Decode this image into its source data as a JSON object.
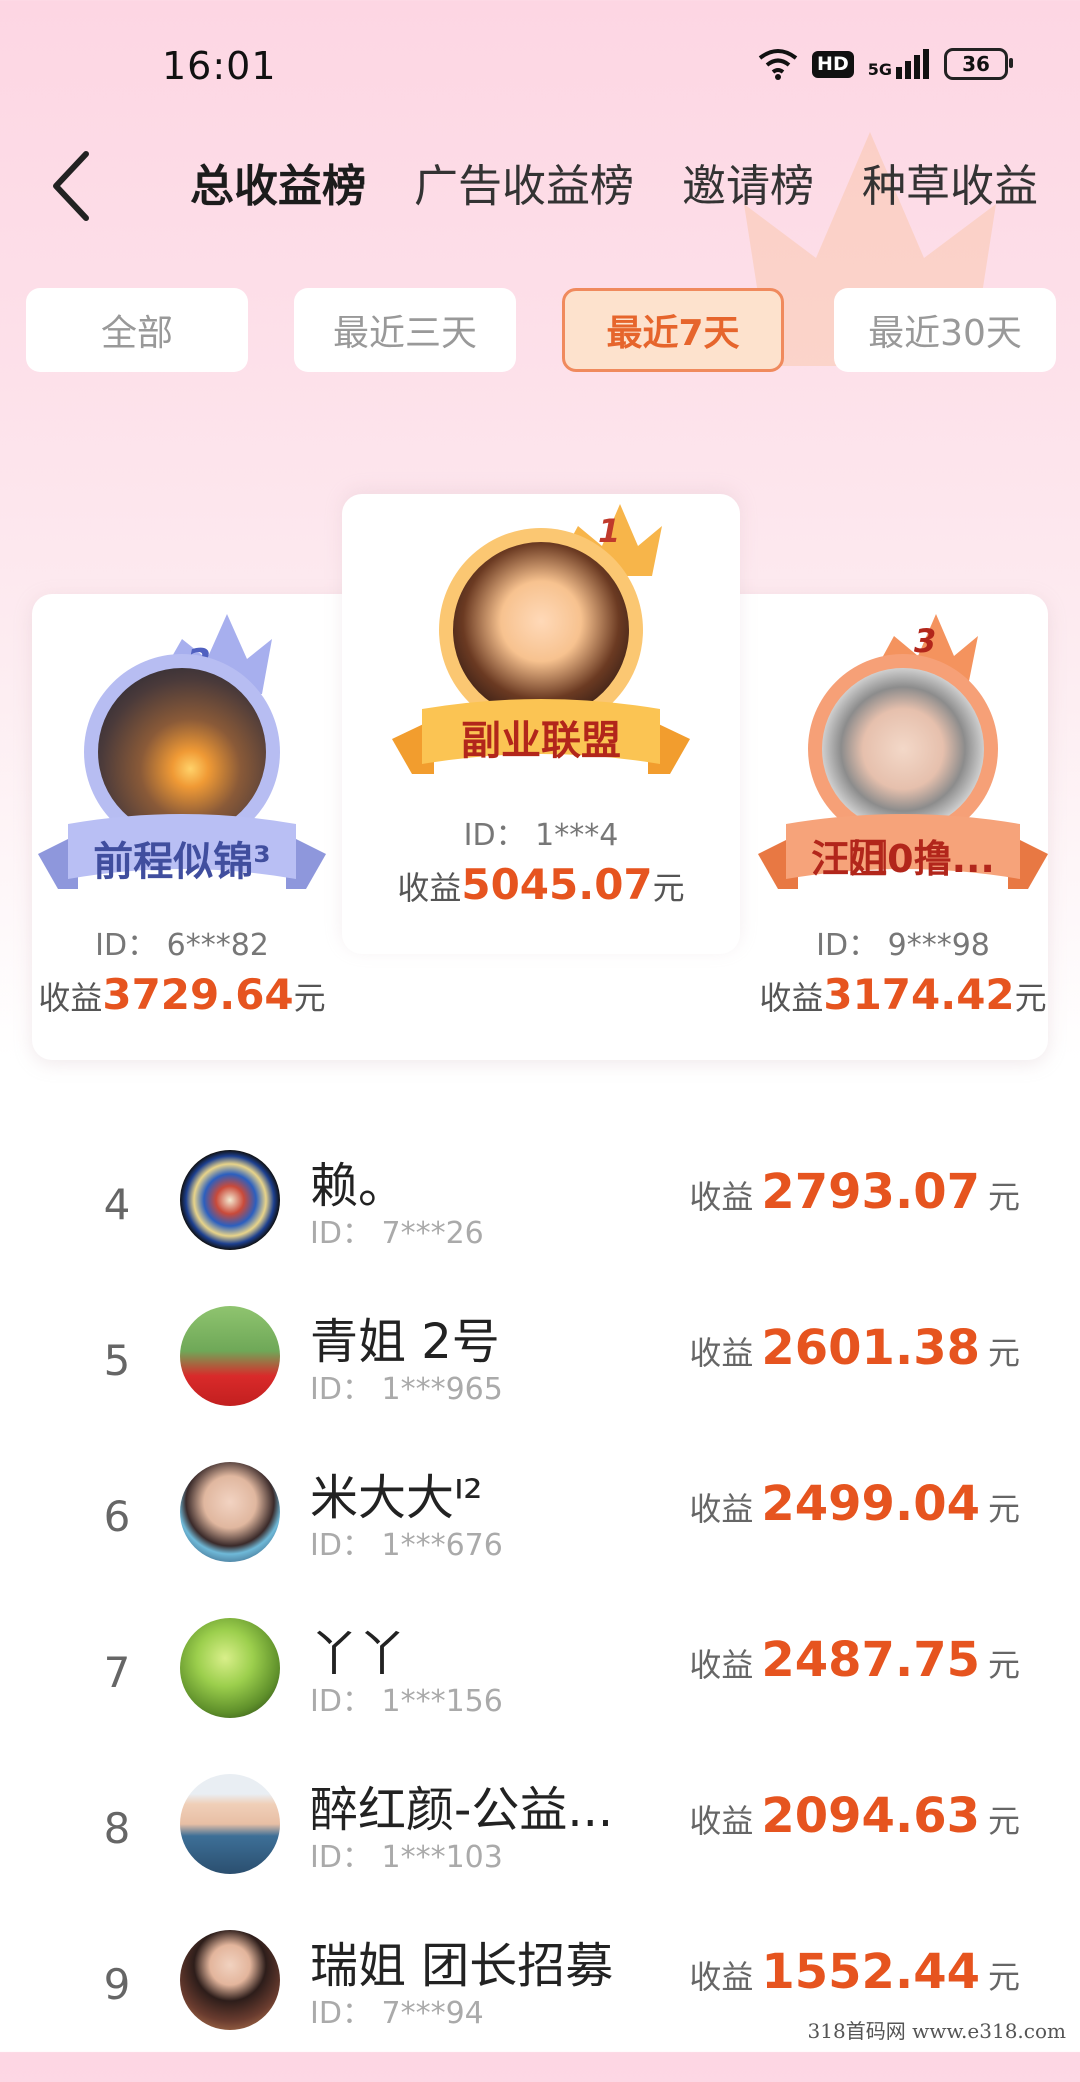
{
  "status_bar": {
    "time": "16:01",
    "hd": "HD",
    "network": "5G",
    "battery": "36"
  },
  "tabs": [
    {
      "label": "总收益榜",
      "active": true
    },
    {
      "label": "广告收益榜",
      "active": false
    },
    {
      "label": "邀请榜",
      "active": false
    },
    {
      "label": "种草收益",
      "active": false
    }
  ],
  "filters": [
    {
      "label": "全部",
      "active": false
    },
    {
      "label": "最近三天",
      "active": false
    },
    {
      "label": "最近7天",
      "active": true
    },
    {
      "label": "最近30天",
      "active": false
    }
  ],
  "podium": {
    "earn_label": "收益",
    "unit": "元",
    "first": {
      "rank": "1",
      "name": "副业联盟",
      "id": "ID：  1***4",
      "earnings": "5045.07"
    },
    "second": {
      "rank": "2",
      "name": "前程似锦³",
      "id": "ID：  6***82",
      "earnings": "3729.64"
    },
    "third": {
      "rank": "3",
      "name": "汪姐⃞0撸...",
      "id": "ID：  9***98",
      "earnings": "3174.42"
    }
  },
  "leaderboard": {
    "earn_label": "收益",
    "unit": "元",
    "rows": [
      {
        "rank": "4",
        "name": "赖。",
        "id": "ID：  7***26",
        "earnings": "2793.07"
      },
      {
        "rank": "5",
        "name": "青姐 2号",
        "id": "ID：  1***965",
        "earnings": "2601.38"
      },
      {
        "rank": "6",
        "name": "米大大ᑊ²",
        "id": "ID：  1***676",
        "earnings": "2499.04"
      },
      {
        "rank": "7",
        "name": "丫丫",
        "id": "ID：  1***156",
        "earnings": "2487.75"
      },
      {
        "rank": "8",
        "name": "醉红颜-公益...",
        "id": "ID：  1***103",
        "earnings": "2094.63"
      },
      {
        "rank": "9",
        "name": "瑞姐 团长招募",
        "id": "ID：  7***94",
        "earnings": "1552.44"
      }
    ]
  },
  "watermark": "318首码网   www.e318.com",
  "colors": {
    "accent": "#e6541f",
    "tab_indicator": "#f36b3a",
    "gold": "#f6a93b",
    "silver": "#9aa3e8",
    "bronze": "#f08a5d"
  }
}
